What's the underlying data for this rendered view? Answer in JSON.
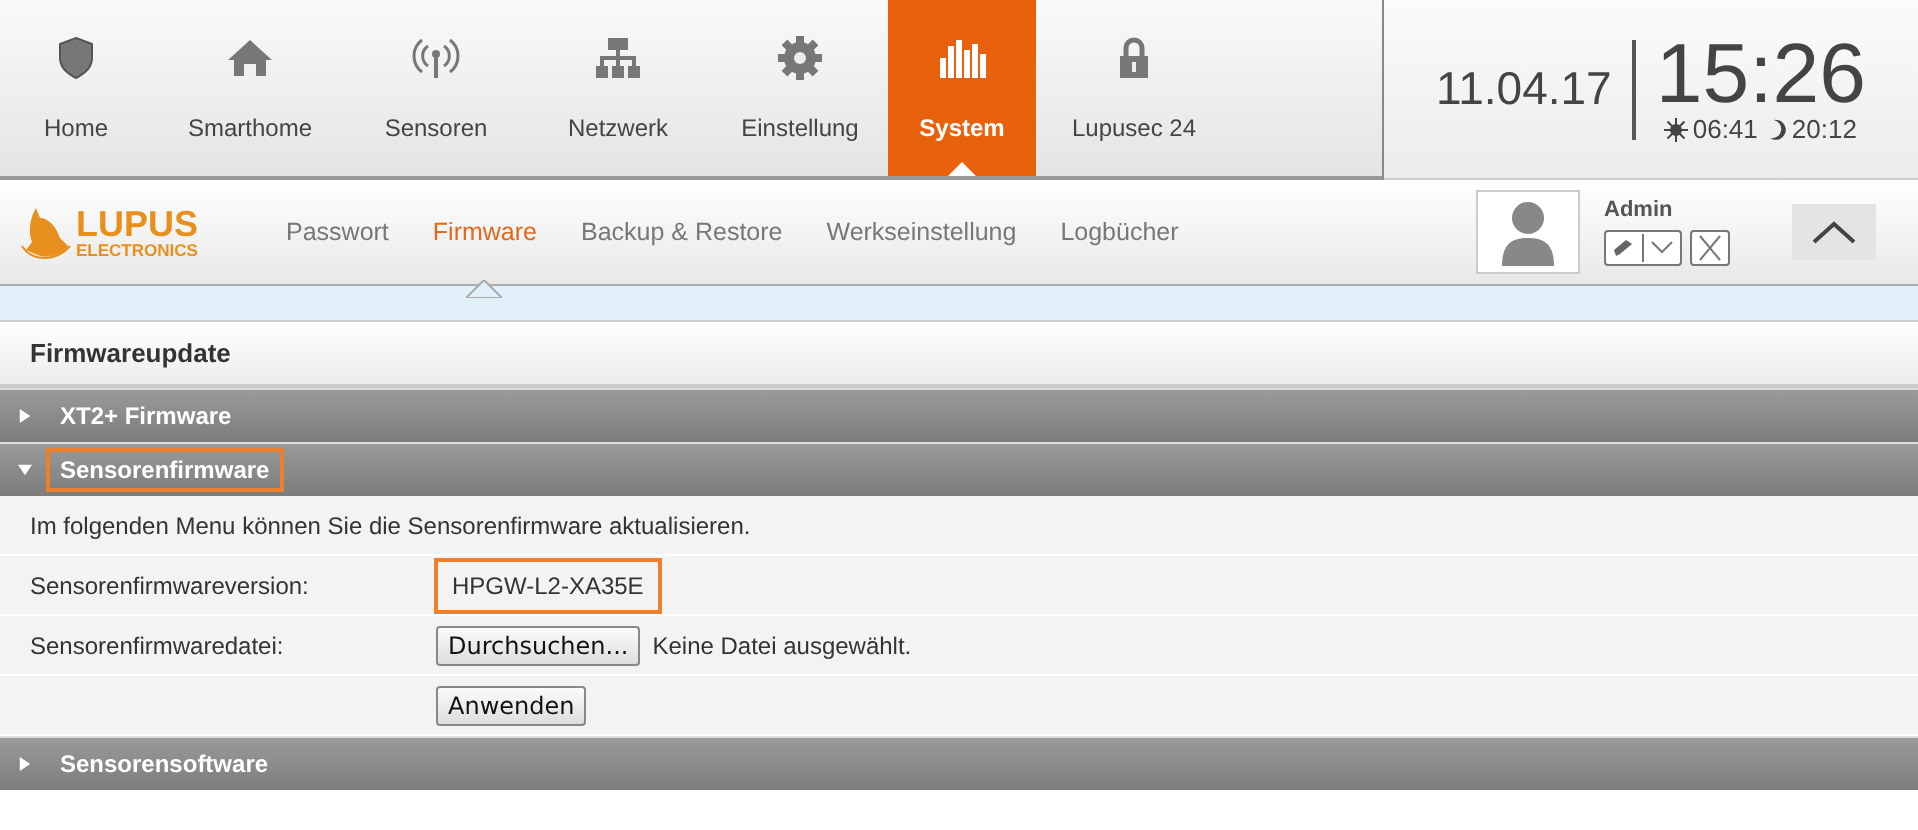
{
  "main_nav": [
    {
      "label": "Home",
      "selected": false
    },
    {
      "label": "Smarthome",
      "selected": false
    },
    {
      "label": "Sensoren",
      "selected": false
    },
    {
      "label": "Netzwerk",
      "selected": false
    },
    {
      "label": "Einstellung",
      "selected": false
    },
    {
      "label": "System",
      "selected": true
    },
    {
      "label": "Lupusec 24",
      "selected": false
    }
  ],
  "clock": {
    "date": "11.04.17",
    "time": "15:26",
    "sunrise": "06:41",
    "sunset": "20:12"
  },
  "logo": {
    "name": "LUPUS",
    "subtitle": "ELECTRONICS"
  },
  "sub_nav": [
    {
      "label": "Passwort",
      "selected": false
    },
    {
      "label": "Firmware",
      "selected": true
    },
    {
      "label": "Backup & Restore",
      "selected": false
    },
    {
      "label": "Werkseinstellung",
      "selected": false
    },
    {
      "label": "Logbücher",
      "selected": false
    }
  ],
  "user": {
    "name": "Admin"
  },
  "panel": {
    "title": "Firmwareupdate",
    "sections": [
      {
        "title": "XT2+ Firmware",
        "expanded": false,
        "highlighted": false
      },
      {
        "title": "Sensorenfirmware",
        "expanded": true,
        "highlighted": true,
        "intro": "Im folgenden Menu können Sie die Sensorenfirmware aktualisieren.",
        "rows": [
          {
            "kind": "value",
            "label": "Sensorenfirmwareversion:",
            "value": "HPGW-L2-XA35E",
            "highlighted": true
          },
          {
            "kind": "file",
            "label": "Sensorenfirmwaredatei:",
            "button": "Durchsuchen...",
            "status": "Keine Datei ausgewählt."
          },
          {
            "kind": "action",
            "button": "Anwenden"
          }
        ]
      },
      {
        "title": "Sensorensoftware",
        "expanded": false,
        "highlighted": false
      }
    ]
  }
}
